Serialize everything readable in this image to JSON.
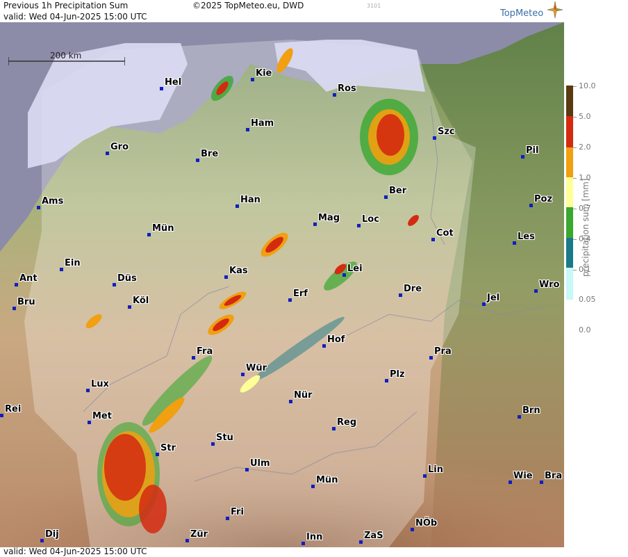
{
  "header": {
    "title": "Previous 1h Precipitation Sum",
    "valid_line": "valid:  Wed  04-Jun-2025 15:00 UTC",
    "copyright": "©2025 TopMeteo.eu, DWD",
    "code": "3101",
    "logo": "TopMeteo"
  },
  "footer": {
    "valid_line": "valid:  Wed  04-Jun-2025 15:00 UTC"
  },
  "scale_bar": {
    "label": "200 km"
  },
  "cities": [
    {
      "name": "Hel"
    },
    {
      "name": "Kie"
    },
    {
      "name": "Ros"
    },
    {
      "name": "Ham"
    },
    {
      "name": "Szc"
    },
    {
      "name": "Gro"
    },
    {
      "name": "Bre"
    },
    {
      "name": "Pil"
    },
    {
      "name": "Ber"
    },
    {
      "name": "Ams"
    },
    {
      "name": "Han"
    },
    {
      "name": "Poz"
    },
    {
      "name": "Mag"
    },
    {
      "name": "Loc"
    },
    {
      "name": "Mün"
    },
    {
      "name": "Cot"
    },
    {
      "name": "Les"
    },
    {
      "name": "Ein"
    },
    {
      "name": "Kas"
    },
    {
      "name": "Lei"
    },
    {
      "name": "Ant"
    },
    {
      "name": "Düs"
    },
    {
      "name": "Wro"
    },
    {
      "name": "Bru"
    },
    {
      "name": "Köl"
    },
    {
      "name": "Erf"
    },
    {
      "name": "Dre"
    },
    {
      "name": "Jel"
    },
    {
      "name": "Hof"
    },
    {
      "name": "Fra"
    },
    {
      "name": "Pra"
    },
    {
      "name": "Wür"
    },
    {
      "name": "Plz"
    },
    {
      "name": "Lux"
    },
    {
      "name": "Nür"
    },
    {
      "name": "Rei"
    },
    {
      "name": "Met"
    },
    {
      "name": "Reg"
    },
    {
      "name": "Brn"
    },
    {
      "name": "Stu"
    },
    {
      "name": "Str"
    },
    {
      "name": "Ulm"
    },
    {
      "name": "Lin"
    },
    {
      "name": "Wie"
    },
    {
      "name": "Bra"
    },
    {
      "name": "Mün"
    },
    {
      "name": "Fri"
    },
    {
      "name": "NÖb"
    },
    {
      "name": "Dij"
    },
    {
      "name": "Zür"
    },
    {
      "name": "Inn"
    },
    {
      "name": "ZaS"
    }
  ],
  "legend": {
    "title": "precipitation sum [mm]",
    "levels": [
      {
        "label": "10.0",
        "color": "#5a3a10"
      },
      {
        "label": "5.0",
        "color": "#d42a10"
      },
      {
        "label": "2.0",
        "color": "#f0a010"
      },
      {
        "label": "1.0",
        "color": "#ffff98"
      },
      {
        "label": "0.7",
        "color": "#3aa830"
      },
      {
        "label": "0.4",
        "color": "#1a7a88"
      },
      {
        "label": "0.1",
        "color": "#c8f8f8"
      },
      {
        "label": "0.05",
        "color": "#ffffff"
      },
      {
        "label": "0.0",
        "color": "#ffffff"
      }
    ]
  }
}
